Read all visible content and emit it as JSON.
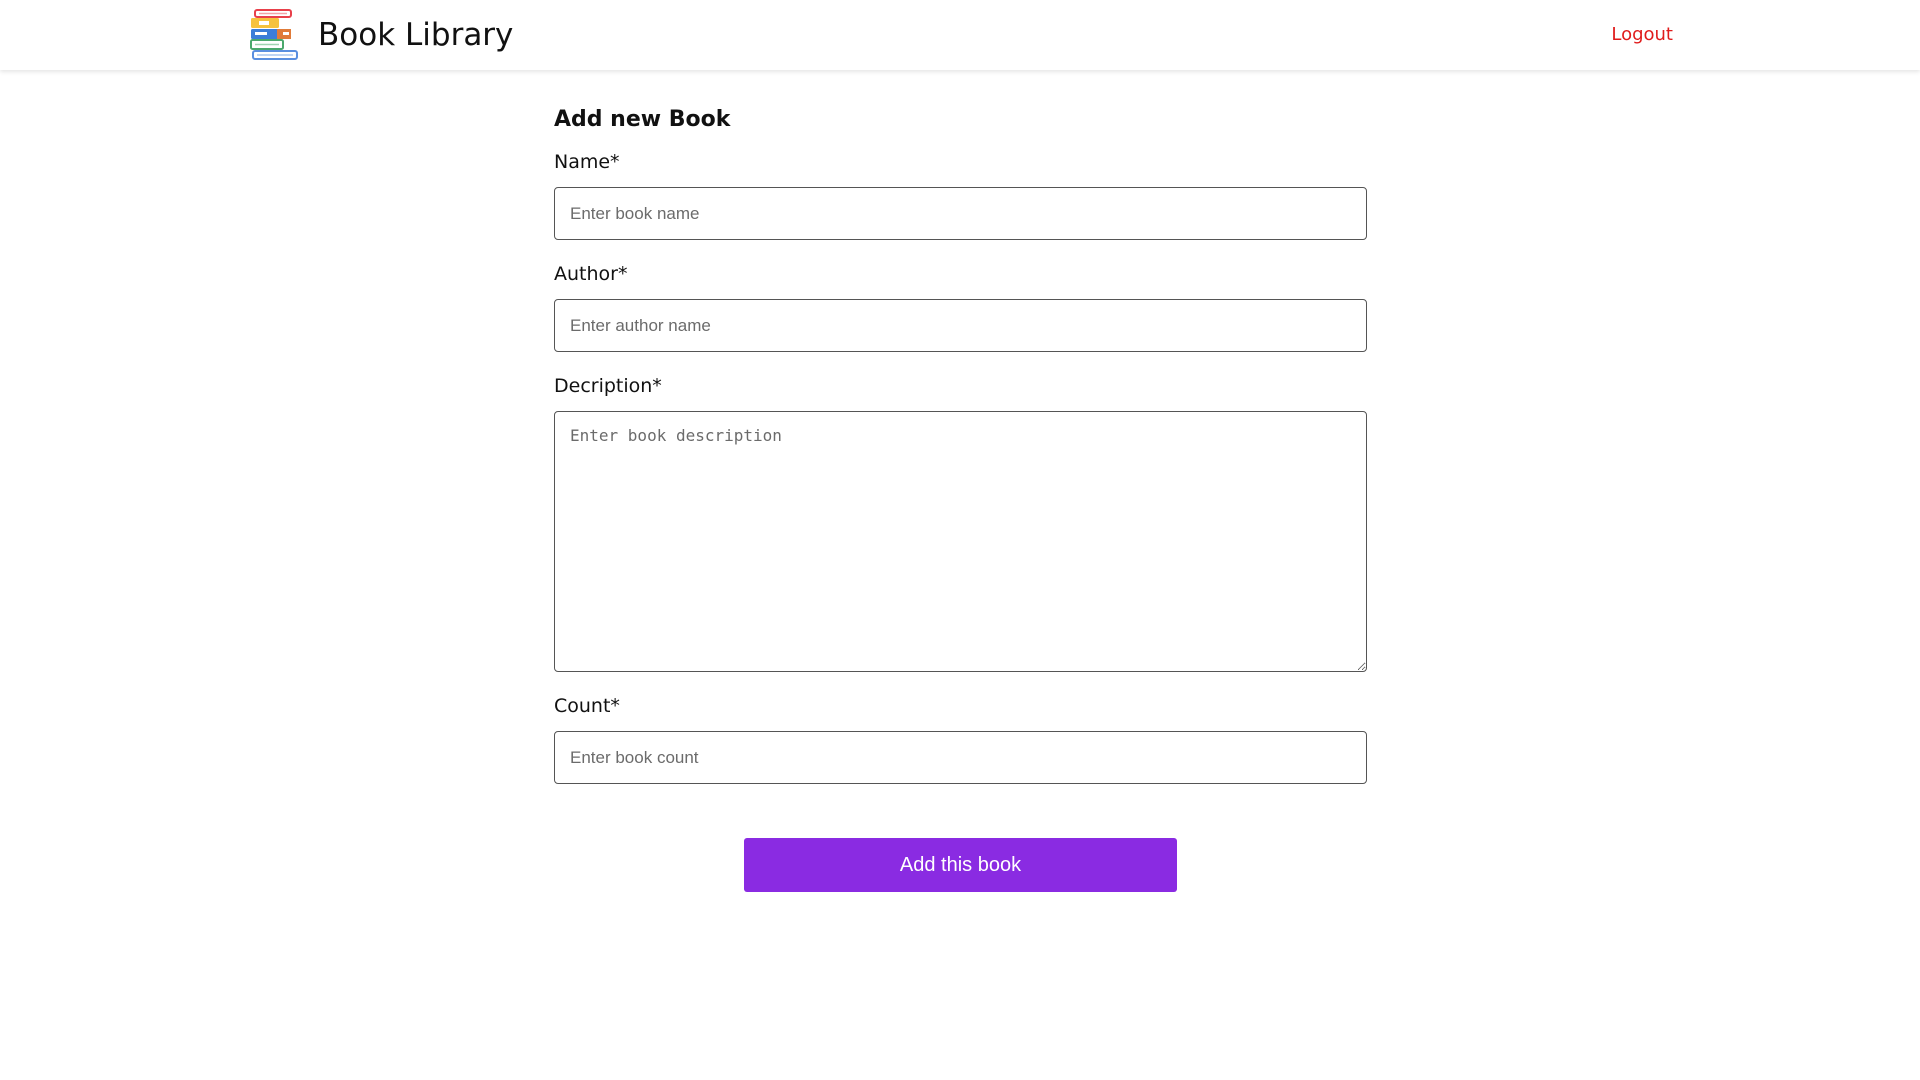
{
  "header": {
    "brand_title": "Book Library",
    "logo_icon": "books-stack-icon",
    "logout_label": "Logout",
    "logout_color": "#e01b1b"
  },
  "form": {
    "title": "Add new Book",
    "name": {
      "label": "Name*",
      "value": "",
      "placeholder": "Enter book name"
    },
    "author": {
      "label": "Author*",
      "value": "",
      "placeholder": "Enter author name"
    },
    "description": {
      "label": "Decription*",
      "value": "",
      "placeholder": "Enter book description"
    },
    "count": {
      "label": "Count*",
      "value": "",
      "placeholder": "Enter book count"
    },
    "submit_label": "Add this book",
    "submit_color": "#8a2be2"
  }
}
